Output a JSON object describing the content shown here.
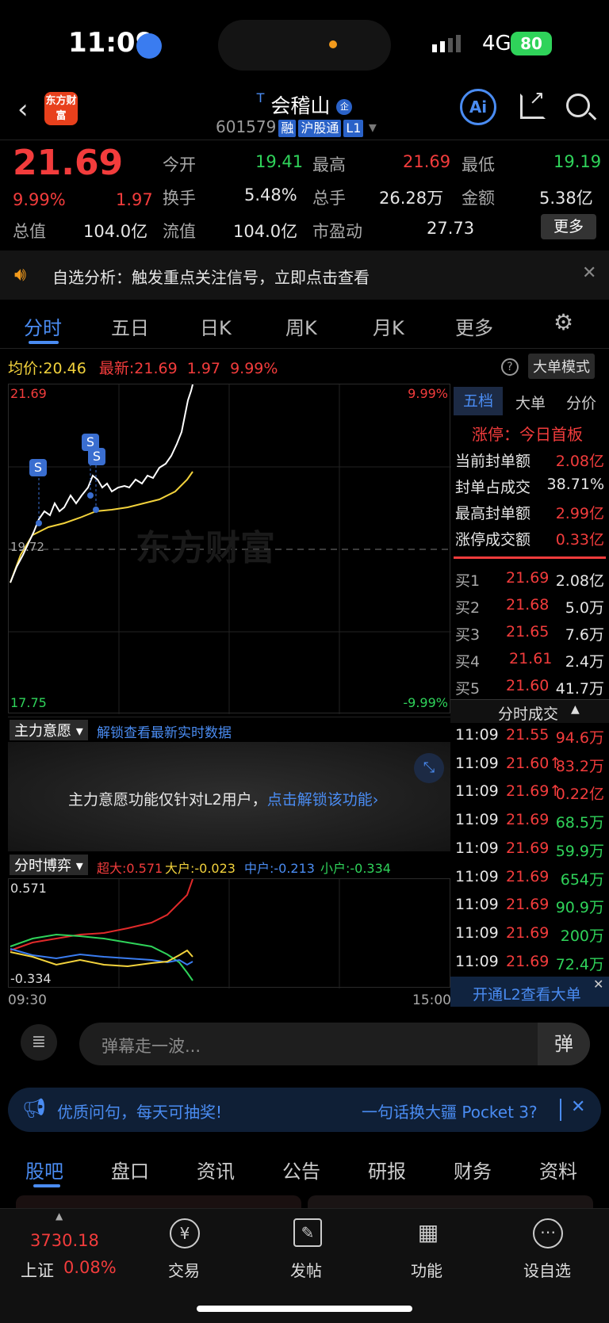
{
  "status": {
    "time": "11:09",
    "network": "4G",
    "battery": "80"
  },
  "header": {
    "logo": "东方财富",
    "title": "会稽山",
    "code": "601579",
    "tags": [
      "融",
      "沪股通",
      "L1"
    ]
  },
  "quote": {
    "price": "21.69",
    "pct": "9.99%",
    "chg": "1.97",
    "items": [
      {
        "label": "今开",
        "value": "19.41"
      },
      {
        "label": "最高",
        "value": "21.69"
      },
      {
        "label": "最低",
        "value": "19.19"
      },
      {
        "label": "换手",
        "value": "5.48%"
      },
      {
        "label": "总手",
        "value": "26.28万"
      },
      {
        "label": "金额",
        "value": "5.38亿"
      },
      {
        "label": "总值",
        "value": "104.0亿"
      },
      {
        "label": "流值",
        "value": "104.0亿"
      },
      {
        "label": "市盈动",
        "value": "27.73"
      }
    ],
    "more": "更多"
  },
  "notice": {
    "text": "自选分析：触发重点关注信号，立即点击查看"
  },
  "tabs": [
    "分时",
    "五日",
    "日K",
    "周K",
    "月K",
    "更多"
  ],
  "info": {
    "avg_label": "均价:",
    "avg": "20.46",
    "last_label": "最新:",
    "last": "21.69",
    "chg": "1.97",
    "pct": "9.99%",
    "mode": "大单模式"
  },
  "chart_labels": {
    "top": "21.69",
    "top_pct": "9.99%",
    "mid": "19.72",
    "bottom": "17.75",
    "bottom_pct": "-9.99%",
    "watermark": "东方财富",
    "time_start": "09:30",
    "time_end": "15:00"
  },
  "right_tabs": [
    "五档",
    "大单",
    "分价"
  ],
  "limit": {
    "title": "涨停：今日首板",
    "rows": [
      {
        "label": "当前封单额",
        "value": "2.08亿"
      },
      {
        "label": "封单占成交",
        "value": "38.71%"
      },
      {
        "label": "最高封单额",
        "value": "2.99亿"
      },
      {
        "label": "涨停成交额",
        "value": "0.33亿"
      }
    ]
  },
  "orderbook": [
    {
      "label": "买1",
      "price": "21.69",
      "vol": "2.08亿"
    },
    {
      "label": "买2",
      "price": "21.68",
      "vol": "5.0万"
    },
    {
      "label": "买3",
      "price": "21.65",
      "vol": "7.6万"
    },
    {
      "label": "买4",
      "price": "21.61",
      "vol": "2.4万"
    },
    {
      "label": "买5",
      "price": "21.60",
      "vol": "41.7万"
    }
  ],
  "trades_title": "分时成交",
  "trades": [
    {
      "t": "11:09",
      "p": "21.55",
      "v": "94.6万"
    },
    {
      "t": "11:09",
      "p": "21.60↑",
      "v": "83.2万"
    },
    {
      "t": "11:09",
      "p": "21.69↑",
      "v": "0.22亿"
    },
    {
      "t": "11:09",
      "p": "21.69",
      "v": "68.5万"
    },
    {
      "t": "11:09",
      "p": "21.69",
      "v": "59.9万"
    },
    {
      "t": "11:09",
      "p": "21.69",
      "v": "654万"
    },
    {
      "t": "11:09",
      "p": "21.69",
      "v": "90.9万"
    },
    {
      "t": "11:09",
      "p": "21.69",
      "v": "200万"
    },
    {
      "t": "11:09",
      "p": "21.69",
      "v": "72.4万"
    }
  ],
  "l2_banner": "开通L2查看大单",
  "main_intent": {
    "label": "主力意愿",
    "link": "解锁查看最新实时数据",
    "msg": "主力意愿功能仅针对L2用户，",
    "msg_link": "点击解锁该功能"
  },
  "game": {
    "label": "分时博弈",
    "big": "超大:0.571",
    "large": "大户:-0.023",
    "mid": "中户:-0.213",
    "small": "小户:-0.334",
    "top": "0.571",
    "bottom": "-0.334"
  },
  "danmu": {
    "placeholder": "弹幕走一波...",
    "btn": "弹"
  },
  "promo": {
    "left": "优质问句，每天可抽奖!",
    "right": "一句话换大疆 Pocket 3?"
  },
  "bottom_tabs": [
    "股吧",
    "盘口",
    "资讯",
    "公告",
    "研报",
    "财务",
    "资料"
  ],
  "footer": {
    "index_value": "3730.18",
    "index_name": "上证",
    "index_pct": "0.08%",
    "items": [
      "交易",
      "发帖",
      "功能",
      "设自选"
    ]
  },
  "colors": {
    "up": "#f23c3c",
    "down": "#2fd35a",
    "avg": "#f2d23c",
    "accent": "#4a8cf2"
  }
}
